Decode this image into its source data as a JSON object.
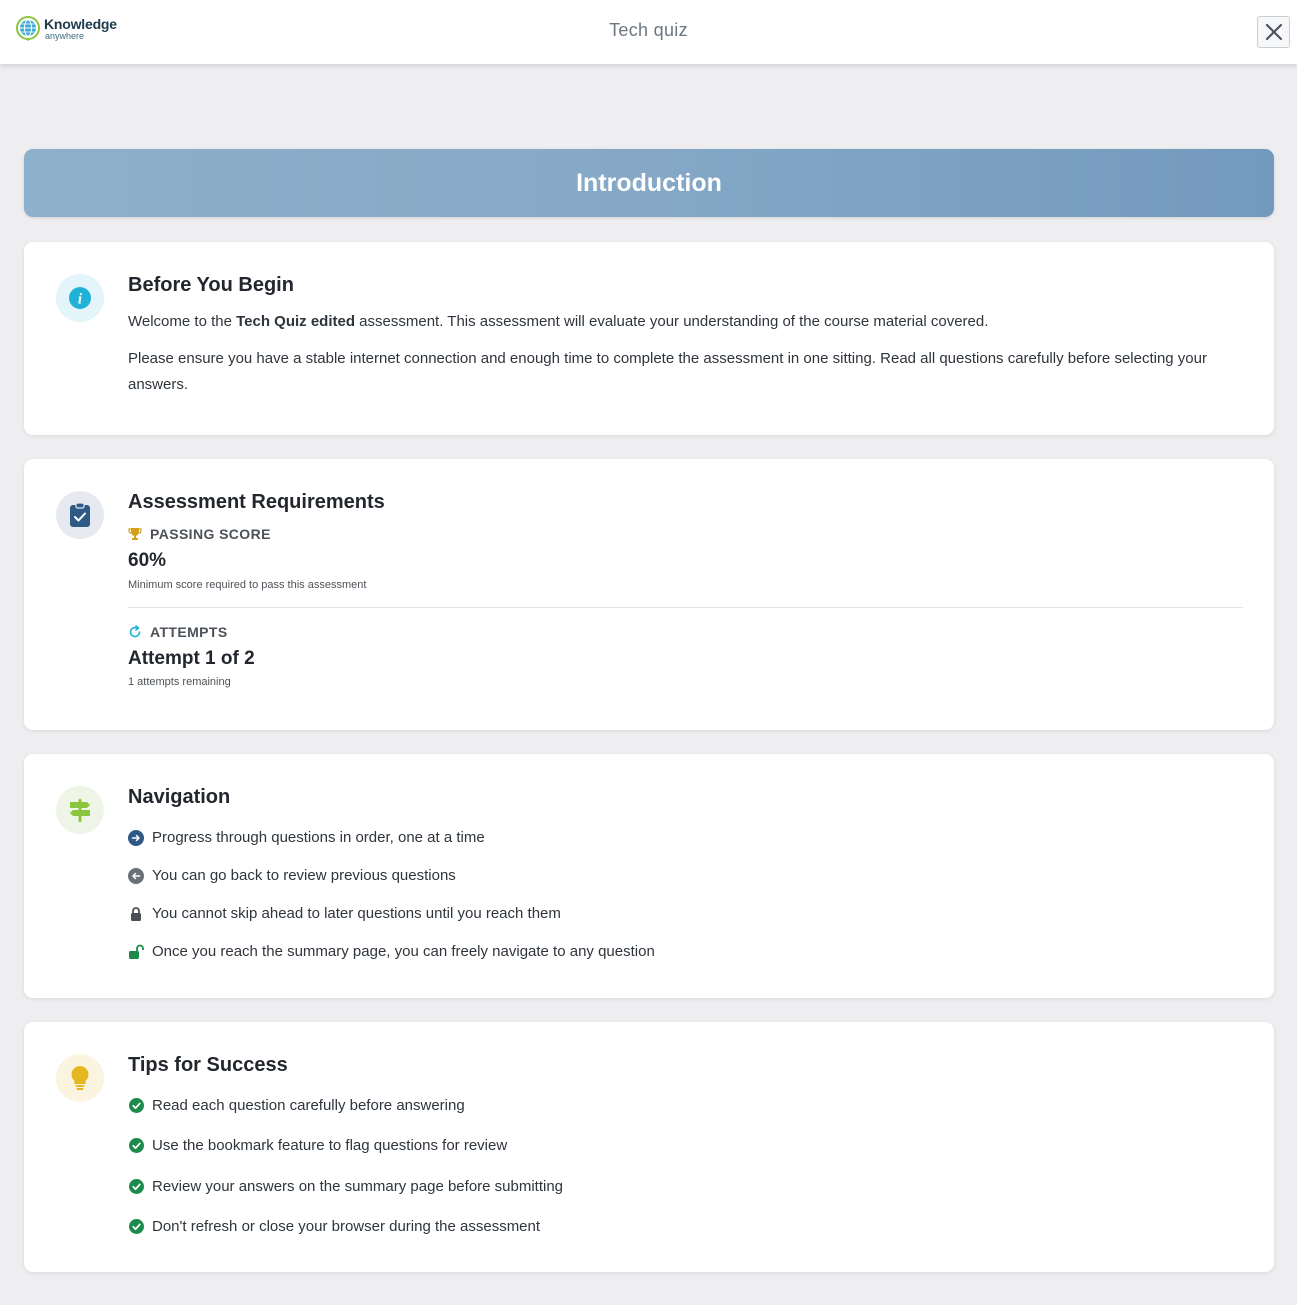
{
  "header": {
    "logo_main": "Knowledge",
    "logo_sub": "anywhere",
    "title": "Tech quiz"
  },
  "banner": {
    "title": "Introduction"
  },
  "before": {
    "title": "Before You Begin",
    "p1_prefix": "Welcome to the ",
    "p1_bold": "Tech Quiz edited",
    "p1_suffix": " assessment. This assessment will evaluate your understanding of the course material covered.",
    "p2": "Please ensure you have a stable internet connection and enough time to complete the assessment in one sitting. Read all questions carefully before selecting your answers."
  },
  "requirements": {
    "title": "Assessment Requirements",
    "passing_label": "PASSING SCORE",
    "passing_value": "60%",
    "passing_note": "Minimum score required to pass this assessment",
    "attempts_label": "ATTEMPTS",
    "attempts_value": "Attempt 1 of 2",
    "attempts_note": "1 attempts remaining"
  },
  "navigation": {
    "title": "Navigation",
    "items": [
      "Progress through questions in order, one at a time",
      "You can go back to review previous questions",
      "You cannot skip ahead to later questions until you reach them",
      "Once you reach the summary page, you can freely navigate to any question"
    ]
  },
  "tips": {
    "title": "Tips for Success",
    "items": [
      "Read each question carefully before answering",
      "Use the bookmark feature to flag questions for review",
      "Review your answers on the summary page before submitting",
      "Don't refresh or close your browser during the assessment"
    ]
  },
  "colors": {
    "banner_start": "#8db0cc",
    "banner_end": "#7399bd",
    "info_icon": "#1fb2d6",
    "clipboard_icon": "#2f5a86",
    "signpost_icon": "#8cc63f",
    "bulb_icon": "#e6b720",
    "check_green": "#1e8a4c"
  },
  "icons": {
    "close": "close-icon",
    "info": "info-icon",
    "clipboard": "clipboard-check-icon",
    "trophy": "trophy-icon",
    "refresh": "refresh-icon",
    "signpost": "signpost-icon",
    "arrow_right": "arrow-right-circle-icon",
    "arrow_left": "arrow-left-circle-icon",
    "lock": "lock-icon",
    "unlock": "unlock-icon",
    "bulb": "lightbulb-icon",
    "check": "check-circle-icon"
  }
}
